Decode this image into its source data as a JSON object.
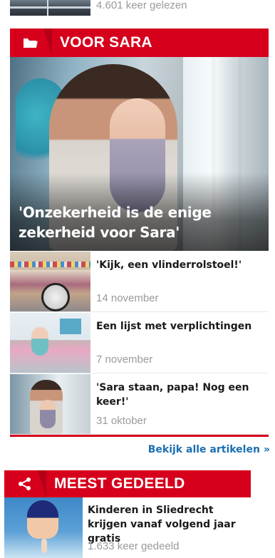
{
  "top_fragment": {
    "reads": "4.601 keer gelezen"
  },
  "voor_sara": {
    "icon": "folder-icon",
    "title": "VOOR SARA",
    "hero": {
      "headline": "'Onzekerheid is de enige zekerheid voor Sara'"
    },
    "items": [
      {
        "title": "'Kijk, een vlinderrolstoel!'",
        "date": "14 november"
      },
      {
        "title": "Een lijst met verplichtingen",
        "date": "7 november"
      },
      {
        "title": "'Sara staan, papa! Nog een keer!'",
        "date": "31 oktober"
      }
    ],
    "more_link": "Bekijk alle artikelen",
    "more_chevron": "»"
  },
  "meest_gedeeld": {
    "icon": "share-icon",
    "title": "MEEST GEDEELD",
    "items": [
      {
        "title": "Kinderen in Sliedrecht krijgen vanaf volgend jaar gratis",
        "shares": "1.633 keer gedeeld"
      }
    ]
  },
  "colors": {
    "accent": "#d6001c",
    "link": "#1b6fb0",
    "muted_text": "#9a9a9a"
  }
}
